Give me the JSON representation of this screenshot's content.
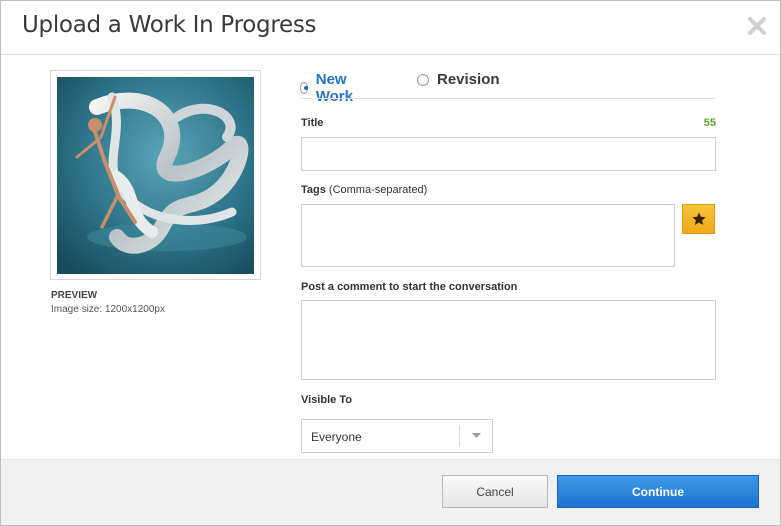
{
  "dialog": {
    "title": "Upload a Work In Progress",
    "close_icon": "close-icon"
  },
  "preview": {
    "label": "PREVIEW",
    "image_size": "Image size: 1200x1200px"
  },
  "mode": {
    "options": [
      {
        "label": "New Work",
        "selected": true
      },
      {
        "label": "Revision",
        "selected": false
      }
    ]
  },
  "form": {
    "title_label": "Title",
    "title_counter": "55",
    "title_value": "",
    "tags_label": "Tags",
    "tags_hint": "(Comma-separated)",
    "tags_value": "",
    "favorite_icon": "star-icon",
    "comment_label": "Post a comment to start the conversation",
    "comment_value": "",
    "visible_label": "Visible To",
    "visible_value": "Everyone"
  },
  "footer": {
    "cancel_label": "Cancel",
    "continue_label": "Continue"
  },
  "colors": {
    "accent": "#2473c7",
    "counter": "#5aa02c",
    "star_button": "#f2b022"
  }
}
